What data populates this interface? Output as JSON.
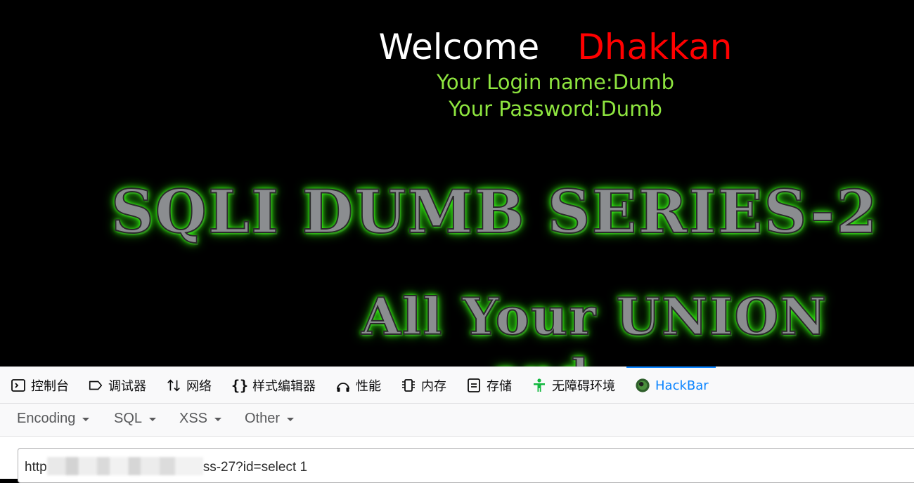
{
  "page": {
    "welcome_word": "Welcome",
    "welcome_name": "Dhakkan",
    "login_line": "Your Login name:Dumb",
    "password_line": "Your Password:Dumb",
    "banner_title": "SQLI DUMB SERIES-2",
    "banner_subtitle": "All Your UNION",
    "banner_partial": "and"
  },
  "devtools": {
    "tabs": [
      {
        "label": "控制台",
        "icon": "console-icon"
      },
      {
        "label": "调试器",
        "icon": "debugger-icon"
      },
      {
        "label": "网络",
        "icon": "network-icon"
      },
      {
        "label": "样式编辑器",
        "icon": "style-editor-icon"
      },
      {
        "label": "性能",
        "icon": "performance-icon"
      },
      {
        "label": "内存",
        "icon": "memory-icon"
      },
      {
        "label": "存储",
        "icon": "storage-icon"
      },
      {
        "label": "无障碍环境",
        "icon": "accessibility-icon"
      },
      {
        "label": "HackBar",
        "icon": "hackbar-icon"
      }
    ],
    "active_tab": "HackBar",
    "accent_color": "#0a84ff"
  },
  "hackbar": {
    "menu": [
      "Encoding",
      "SQL",
      "XSS",
      "Other"
    ],
    "url_prefix": "http",
    "url_suffix": "ss-27?id=select 1"
  },
  "colors": {
    "welcome": "#ffffff",
    "name": "#ff0000",
    "credentials": "#8ee53f",
    "glow": "#39ff14"
  }
}
